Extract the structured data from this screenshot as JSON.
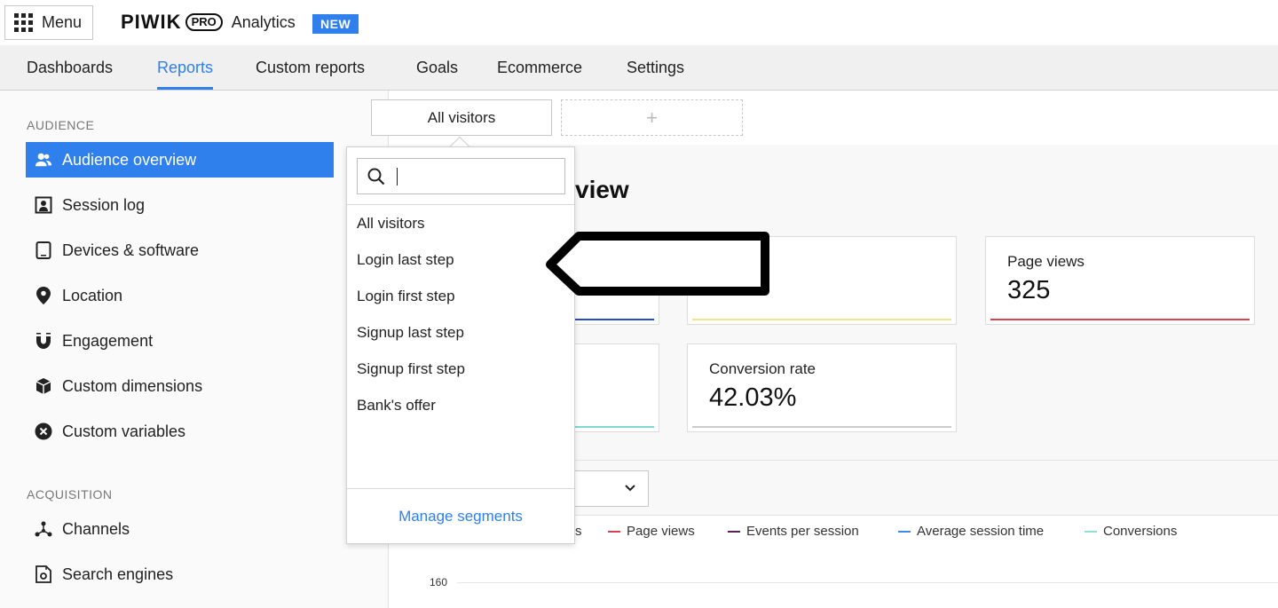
{
  "topbar": {
    "menu_label": "Menu",
    "logo_word": "PIWIK",
    "logo_pro": "PRO",
    "logo_product": "Analytics",
    "badge": "NEW"
  },
  "nav": {
    "items": [
      "Dashboards",
      "Reports",
      "Custom reports",
      "Goals",
      "Ecommerce",
      "Settings"
    ],
    "active": "Reports"
  },
  "sidebar": {
    "audience_heading": "AUDIENCE",
    "audience_items": [
      {
        "label": "Audience overview",
        "icon": "users-icon"
      },
      {
        "label": "Session log",
        "icon": "person-card-icon"
      },
      {
        "label": "Devices & software",
        "icon": "tablet-icon"
      },
      {
        "label": "Location",
        "icon": "location-pin-icon"
      },
      {
        "label": "Engagement",
        "icon": "magnet-icon"
      },
      {
        "label": "Custom dimensions",
        "icon": "cube-icon"
      },
      {
        "label": "Custom variables",
        "icon": "variable-x-icon"
      }
    ],
    "acquisition_heading": "ACQUISITION",
    "acquisition_items": [
      {
        "label": "Channels",
        "icon": "channels-icon"
      },
      {
        "label": "Search engines",
        "icon": "search-engine-icon"
      }
    ]
  },
  "segments": {
    "current": "All visitors",
    "add_symbol": "+"
  },
  "page": {
    "title_visible": "view"
  },
  "cards": [
    {
      "label": "Page views",
      "value": "325",
      "color": "#d9434f"
    },
    {
      "label": "Conversion rate",
      "value": "42.03%",
      "color": "#cccccc"
    },
    {
      "label": "",
      "value": "",
      "color": "#f4e38a"
    },
    {
      "label": "",
      "value": "",
      "color": "#2a47c4"
    },
    {
      "label": "",
      "value": "",
      "color": "#7fd9d4"
    }
  ],
  "legend": [
    {
      "label": "s",
      "color": "#000000"
    },
    {
      "label": "Page views",
      "color": "#d9434f"
    },
    {
      "label": "Events per session",
      "color": "#5a1f5e"
    },
    {
      "label": "Average session time",
      "color": "#3b8be8"
    },
    {
      "label": "Conversions",
      "color": "#8fe0d6"
    }
  ],
  "chart": {
    "y_tick": "160"
  },
  "popup": {
    "search_placeholder": "",
    "items": [
      "All visitors",
      "Login last step",
      "Login first step",
      "Signup last step",
      "Signup first step",
      "Bank's offer"
    ],
    "manage_label": "Manage segments"
  },
  "colors": {
    "accent": "#2f80ed"
  }
}
